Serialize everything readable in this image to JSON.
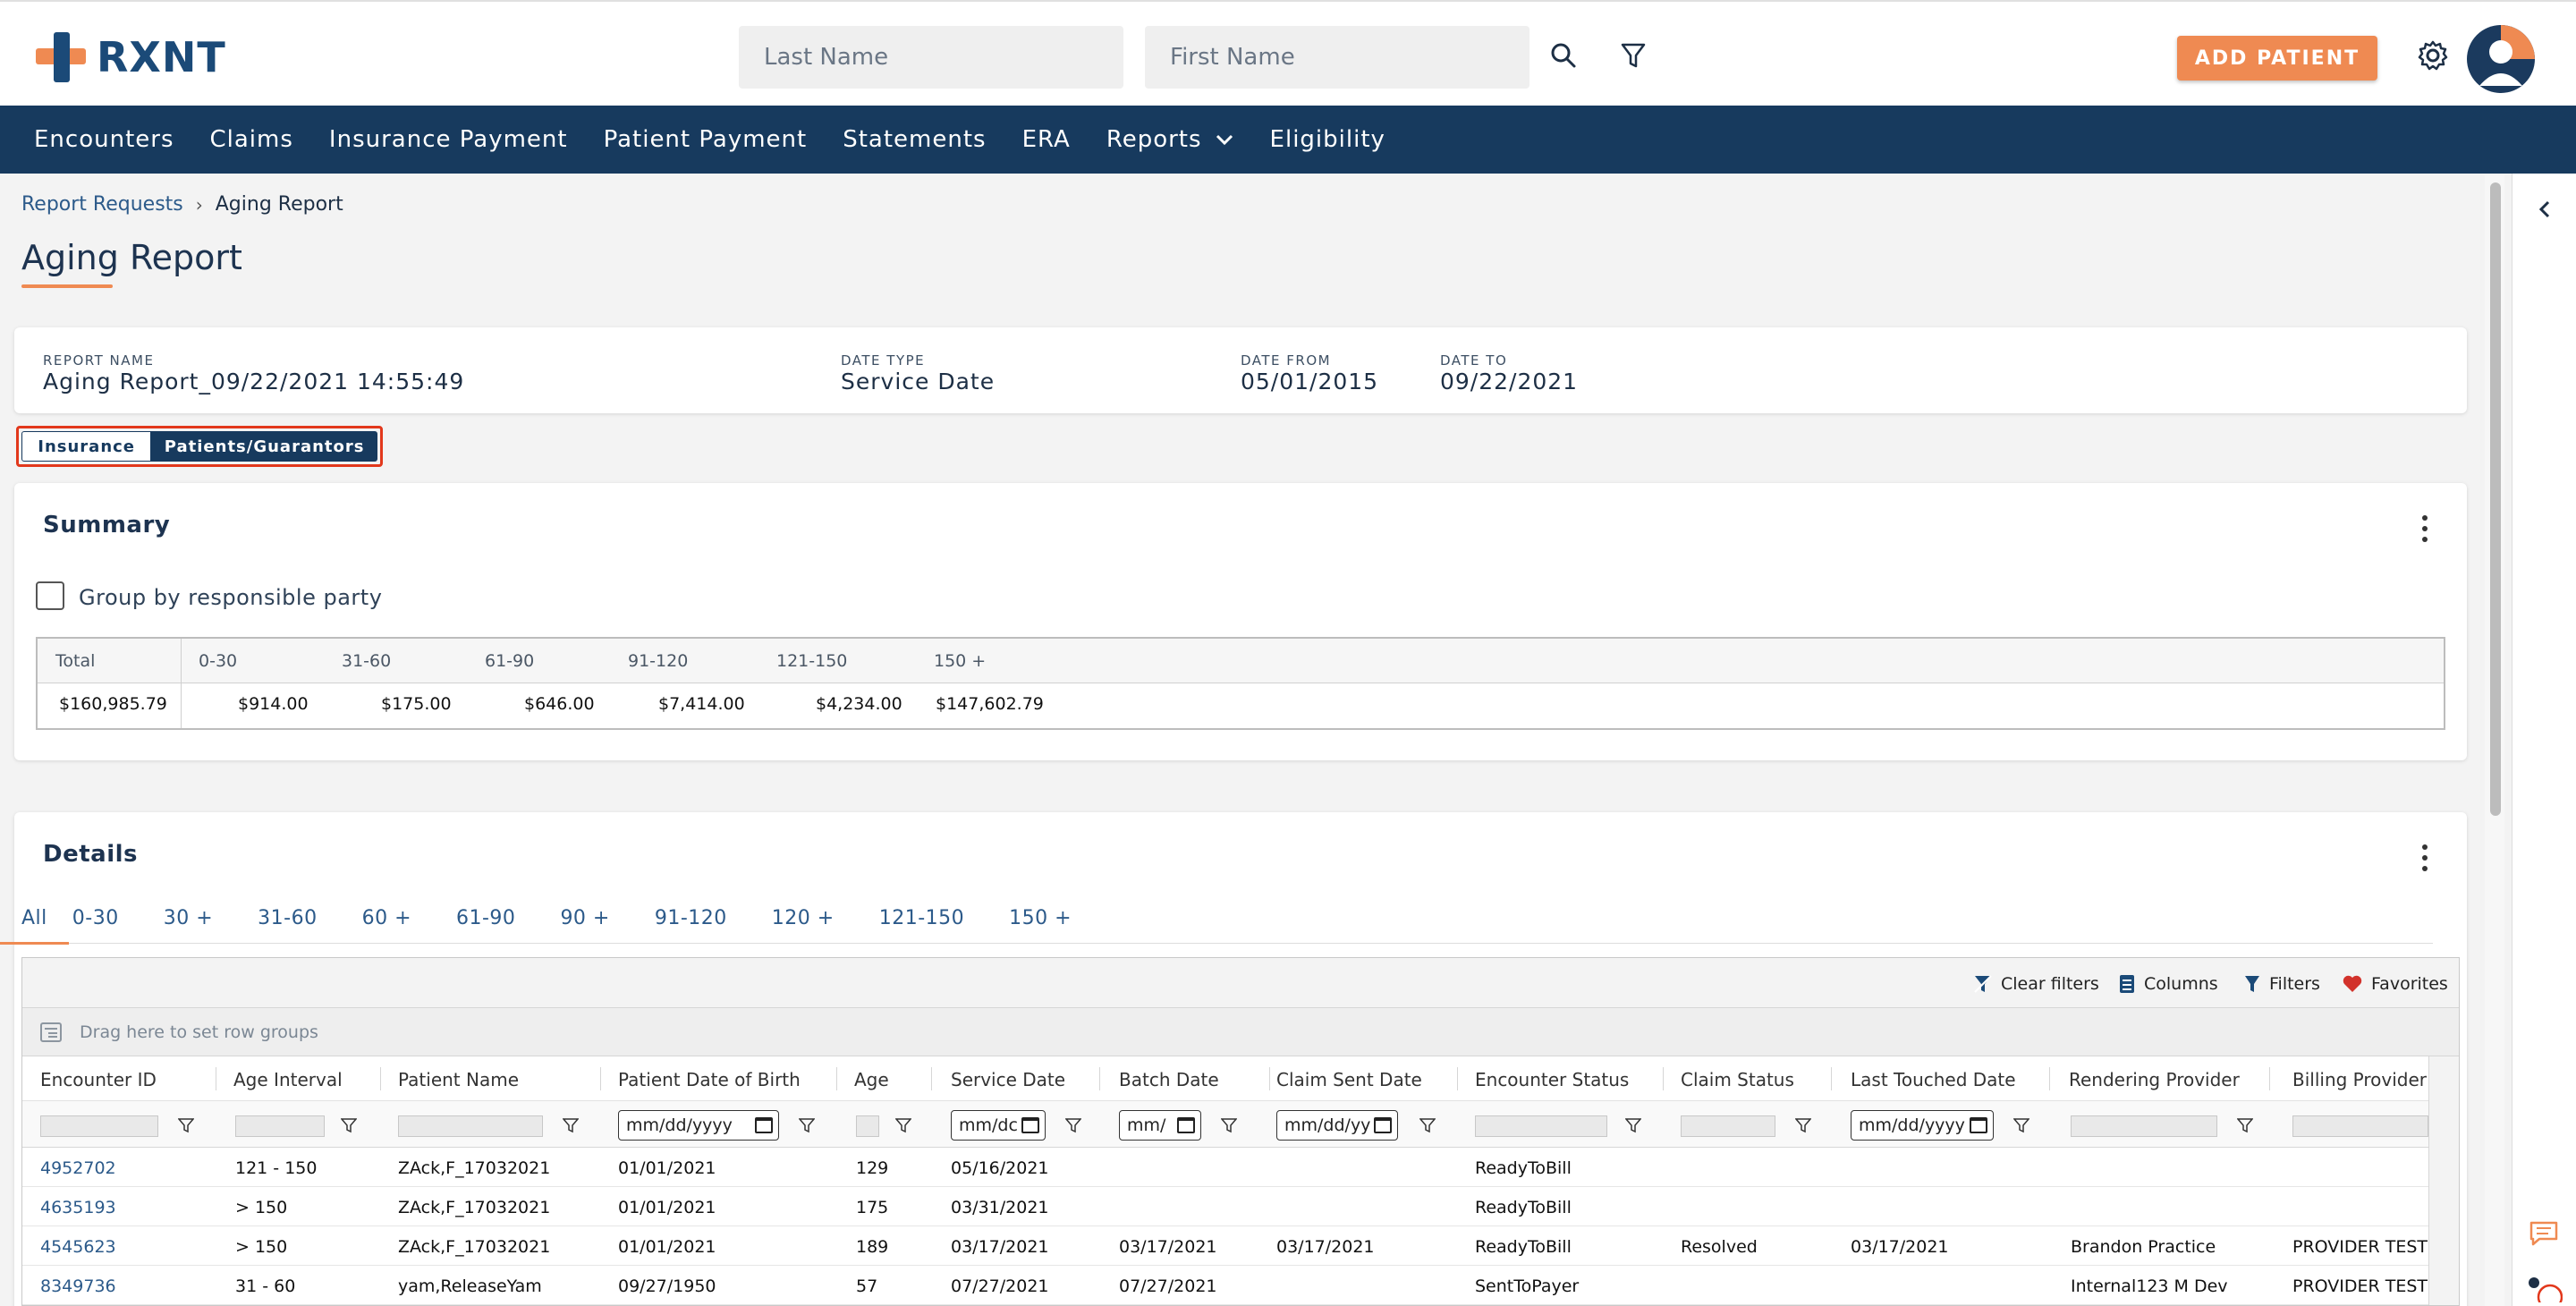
{
  "brand": {
    "name": "RXNT"
  },
  "search": {
    "last_name_placeholder": "Last Name",
    "first_name_placeholder": "First Name"
  },
  "header": {
    "add_patient_label": "ADD PATIENT"
  },
  "nav": {
    "items": [
      {
        "label": "Encounters"
      },
      {
        "label": "Claims"
      },
      {
        "label": "Insurance Payment"
      },
      {
        "label": "Patient Payment"
      },
      {
        "label": "Statements"
      },
      {
        "label": "ERA"
      },
      {
        "label": "Reports"
      },
      {
        "label": "Eligibility"
      }
    ]
  },
  "breadcrumb": {
    "parent": "Report Requests",
    "current": "Aging Report"
  },
  "page": {
    "title": "Aging Report"
  },
  "report_meta": {
    "report_name_label": "REPORT NAME",
    "report_name": "Aging Report_09/22/2021 14:55:49",
    "date_type_label": "DATE TYPE",
    "date_type": "Service Date",
    "date_from_label": "DATE FROM",
    "date_from": "05/01/2015",
    "date_to_label": "DATE TO",
    "date_to": "09/22/2021"
  },
  "view_toggle": {
    "insurance": "Insurance",
    "patients": "Patients/Guarantors",
    "selected": "Patients/Guarantors"
  },
  "summary": {
    "title": "Summary",
    "group_by_label": "Group by responsible party",
    "group_by_checked": false,
    "headers": [
      "Total",
      "0-30",
      "31-60",
      "61-90",
      "91-120",
      "121-150",
      "150 +"
    ],
    "values": [
      "$160,985.79",
      "$914.00",
      "$175.00",
      "$646.00",
      "$7,414.00",
      "$4,234.00",
      "$147,602.79"
    ]
  },
  "details": {
    "title": "Details",
    "tabs": [
      "All",
      "0-30",
      "30 +",
      "31-60",
      "60 +",
      "61-90",
      "90 +",
      "91-120",
      "120 +",
      "121-150",
      "150 +"
    ],
    "active_tab": "All",
    "toolbar": {
      "clear_filters": "Clear filters",
      "columns": "Columns",
      "filters": "Filters",
      "favorites": "Favorites"
    },
    "group_placeholder": "Drag here to set row groups",
    "columns": [
      "Encounter ID",
      "Age Interval",
      "Patient Name",
      "Patient Date of Birth",
      "Age",
      "Service Date",
      "Batch Date",
      "Claim Sent Date",
      "Encounter Status",
      "Claim Status",
      "Last Touched Date",
      "Rendering Provider",
      "Billing Provider"
    ],
    "date_filter_placeholders": [
      "mm/dd/yyyy",
      "mm/dc",
      "mm/",
      "mm/dd/yy",
      "mm/dd/yyyy"
    ],
    "rows": [
      [
        "4952702",
        "121 - 150",
        "ZAck,F_17032021",
        "01/01/2021",
        "129",
        "05/16/2021",
        "",
        "",
        "ReadyToBill",
        "",
        "",
        "",
        ""
      ],
      [
        "4635193",
        "> 150",
        "ZAck,F_17032021",
        "01/01/2021",
        "175",
        "03/31/2021",
        "",
        "",
        "ReadyToBill",
        "",
        "",
        "",
        ""
      ],
      [
        "4545623",
        "> 150",
        "ZAck,F_17032021",
        "01/01/2021",
        "189",
        "03/17/2021",
        "03/17/2021",
        "03/17/2021",
        "ReadyToBill",
        "Resolved",
        "03/17/2021",
        "Brandon Practice",
        "PROVIDER TEST"
      ],
      [
        "8349736",
        "31 - 60",
        "yam,ReleaseYam",
        "09/27/1950",
        "57",
        "07/27/2021",
        "07/27/2021",
        "",
        "SentToPayer",
        "",
        "",
        "Internal123 M Dev",
        "PROVIDER TEST"
      ]
    ]
  },
  "colors": {
    "navy": "#173a5e",
    "accent": "#ef8a52",
    "link": "#2c5a8a",
    "highlight": "#e2381c"
  },
  "icons": [
    "search-icon",
    "filter-icon",
    "gear-icon",
    "user-avatar",
    "chevron-left-icon",
    "chat-icon",
    "help-icon"
  ]
}
